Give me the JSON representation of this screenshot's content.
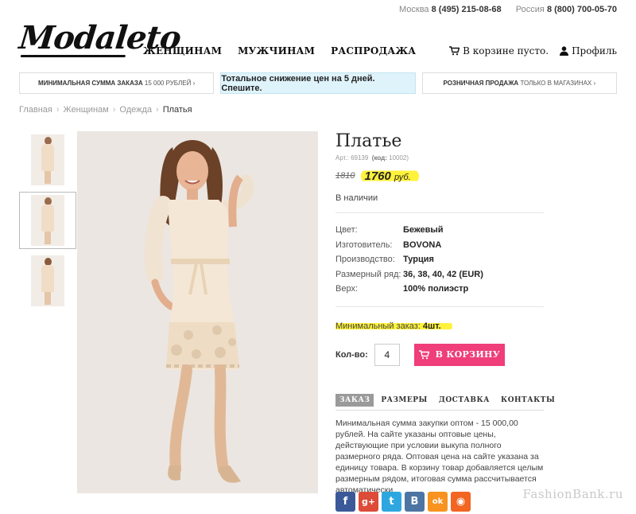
{
  "topbar": {
    "moscow_label": "Москва",
    "moscow_phone": "8 (495) 215-08-68",
    "russia_label": "Россия",
    "russia_phone": "8 (800) 700-05-70"
  },
  "brand": {
    "logo_text": "Modaleto"
  },
  "nav": {
    "women": "ЖЕНЩИНАМ",
    "men": "МУЖЧИНАМ",
    "sale": "РАСПРОДАЖА"
  },
  "user": {
    "cart_icon": "cart-icon",
    "cart_label": "В корзине пусто.",
    "profile_icon": "user-icon",
    "profile_label": "Профиль"
  },
  "banners": {
    "left_strong": "МИНИМАЛЬНАЯ СУММА ЗАКАЗА",
    "left_rest": "15 000 рублей ›",
    "middle": "Тотальное снижение цен на 5 дней. Спешите.",
    "right_strong": "РОЗНИЧНАЯ ПРОДАЖА",
    "right_rest": "ТОЛЬКО В МАГАЗИНАХ ›"
  },
  "breadcrumbs": {
    "home": "Главная",
    "women": "Женщинам",
    "clothes": "Одежда",
    "current": "Платья",
    "separator": "›"
  },
  "product": {
    "title": "Платье",
    "article_label": "Арт.:",
    "article": "69139",
    "code_label": "(код:",
    "code": "10002)",
    "old_price": "1810",
    "new_price": "1760",
    "currency": "руб.",
    "stock": "В наличии",
    "specs": [
      {
        "key": "Цвет:",
        "value": "Бежевый"
      },
      {
        "key": "Изготовитель:",
        "value": "BOVONA"
      },
      {
        "key": "Производство:",
        "value": "Турция"
      },
      {
        "key": "Размерный ряд:",
        "value": "36, 38, 40, 42 (EUR)"
      },
      {
        "key": "Верх:",
        "value": "100% полиэстр"
      }
    ],
    "min_order_label": "Минимальный заказ:",
    "min_order_value": "4шт.",
    "qty_label": "Кол-во:",
    "qty_value": "4",
    "cart_button": "В КОРЗИНУ"
  },
  "tabs": {
    "order": "ЗАКАЗ",
    "sizes": "РАЗМЕРЫ",
    "delivery": "ДОСТАВКА",
    "contacts": "КОНТАКТЫ"
  },
  "tab_text": "Минимальная сумма закупки оптом - 15 000,00 рублей. На сайте указаны оптовые цены, действующие при условии выкупа полного размерного ряда. Оптовая цена на сайте указана за единицу товара. В корзину товар добавляется целым размерным рядом, итоговая сумма рассчитывается автоматически.",
  "social": [
    {
      "icon": "facebook-icon",
      "glyph": "f",
      "color": "#3b5998"
    },
    {
      "icon": "google-plus-icon",
      "glyph": "g+",
      "color": "#dd4b39"
    },
    {
      "icon": "twitter-icon",
      "glyph": "t",
      "color": "#2ea7e0"
    },
    {
      "icon": "vk-icon",
      "glyph": "B",
      "color": "#4c75a3"
    },
    {
      "icon": "odnoklassniki-icon",
      "glyph": "ok",
      "color": "#f7931e"
    },
    {
      "icon": "rss-icon",
      "glyph": "◉",
      "color": "#f26522"
    }
  ],
  "watermark": "FashionBank.ru",
  "colors": {
    "accent": "#ef3e7a",
    "highlight": "#fff23a",
    "banner_bg": "#dff3fb"
  }
}
